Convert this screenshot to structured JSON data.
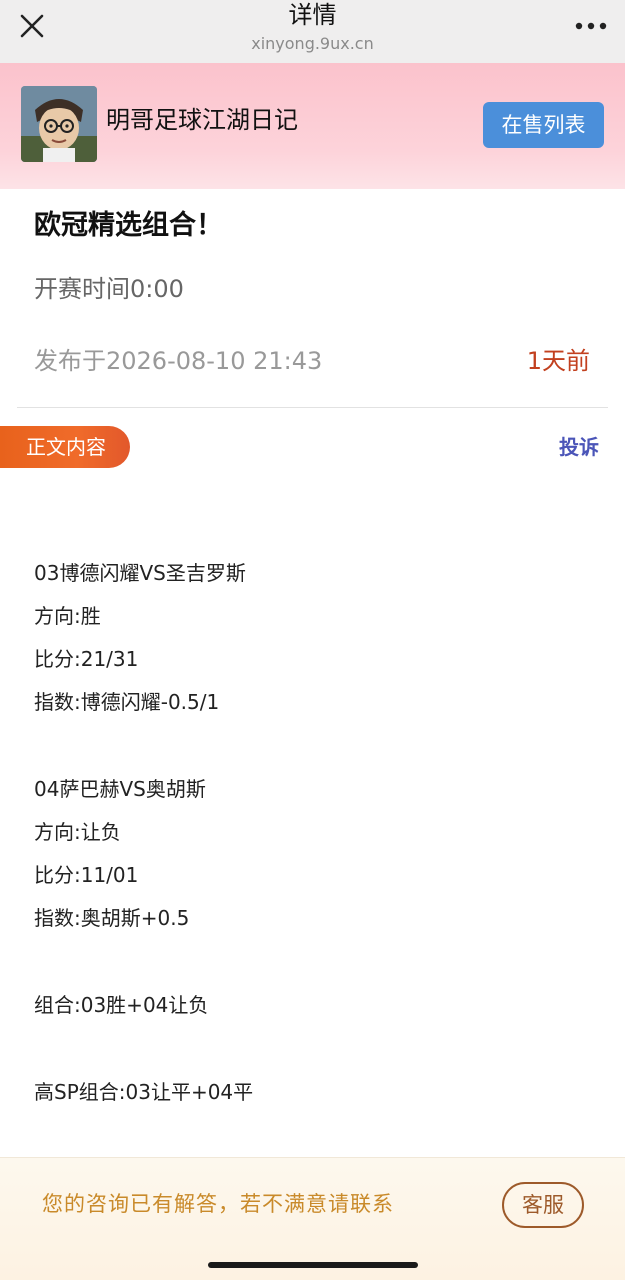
{
  "nav": {
    "title": "详情",
    "domain": "xinyong.9ux.cn",
    "close_icon": "close-icon",
    "more_icon": "more-dots-icon"
  },
  "seller": {
    "name": "明哥足球江湖日记",
    "sale_list_label": "在售列表",
    "accent": "#4b8fda"
  },
  "article": {
    "title": "欧冠精选组合！",
    "kickoff": "开赛时间0:00",
    "published": "发布于2026-08-10 21:43",
    "ago": "1天前",
    "section_label": "正文内容",
    "complain_label": "投诉",
    "lines": [
      "03博德闪耀VS圣吉罗斯",
      "方向:胜",
      "比分:21/31",
      "指数:博德闪耀-0.5/1",
      "04萨巴赫VS奥胡斯",
      "方向:让负",
      "比分:11/01",
      "指数:奥胡斯+0.5",
      "组合:03胜+04让负",
      "高SP组合:03让平+04平"
    ]
  },
  "bottom": {
    "notice": "您的咨询已有解答，若不满意请联系",
    "service_label": "客服"
  }
}
